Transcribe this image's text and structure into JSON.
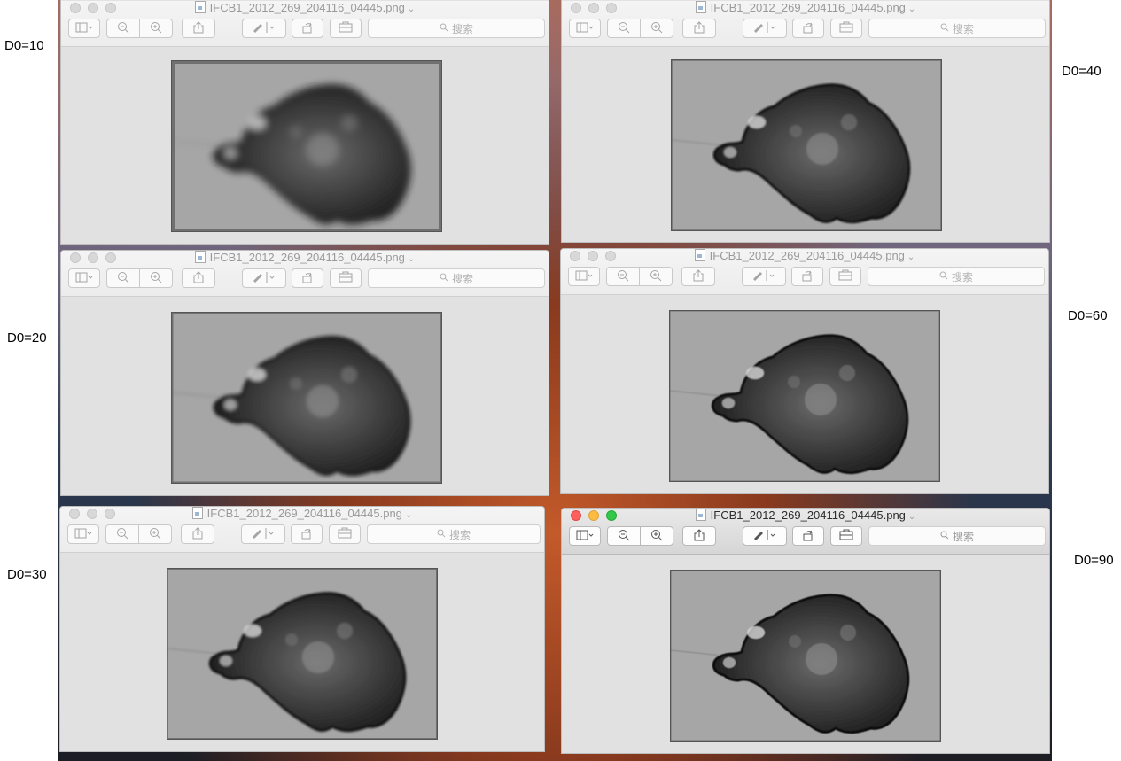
{
  "labels": [
    "D0=10",
    "D0=40",
    "D0=20",
    "D0=60",
    "D0=30",
    "D0=90"
  ],
  "window": {
    "title": "IFCB1_2012_269_204116_04445.png",
    "search_placeholder": "搜索"
  },
  "panels": [
    {
      "label": "D0=10",
      "cutoff": 10,
      "active": false
    },
    {
      "label": "D0=40",
      "cutoff": 40,
      "active": false
    },
    {
      "label": "D0=20",
      "cutoff": 20,
      "active": false
    },
    {
      "label": "D0=60",
      "cutoff": 60,
      "active": false
    },
    {
      "label": "D0=30",
      "cutoff": 30,
      "active": false
    },
    {
      "label": "D0=90",
      "cutoff": 90,
      "active": true
    }
  ],
  "icons": [
    "sidebar-icon",
    "zoom-out-icon",
    "zoom-in-icon",
    "share-icon",
    "markup-icon",
    "rotate-icon",
    "toolbox-icon",
    "search-icon"
  ]
}
